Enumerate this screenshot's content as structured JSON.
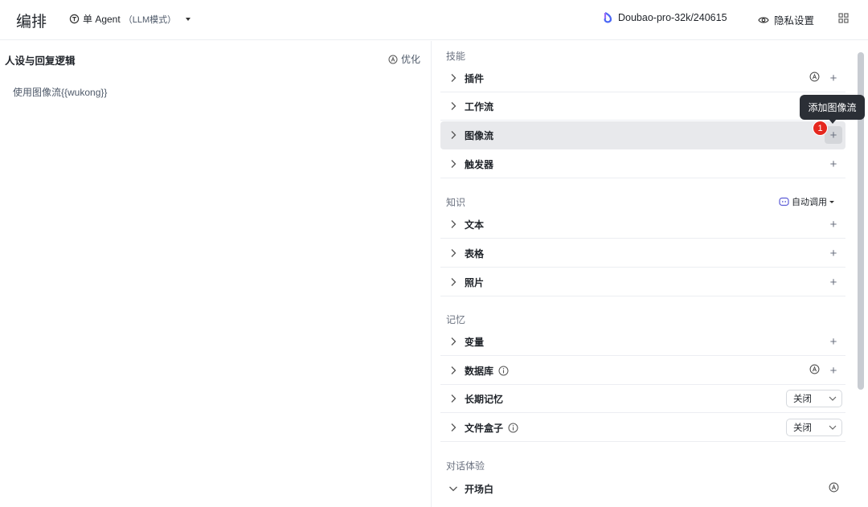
{
  "header": {
    "title": "编排",
    "mode_label": "单 Agent",
    "mode_sub": "（LLM模式）",
    "model": "Doubao-pro-32k/240615",
    "privacy": "隐私设置"
  },
  "left": {
    "title": "人设与回复逻辑",
    "optimize": "优化",
    "prompt": "使用图像流{{wukong}}"
  },
  "skills": {
    "title": "技能",
    "items": [
      {
        "label": "插件"
      },
      {
        "label": "工作流"
      },
      {
        "label": "图像流"
      },
      {
        "label": "触发器"
      }
    ]
  },
  "knowledge": {
    "title": "知识",
    "auto_call": "自动调用",
    "items": [
      {
        "label": "文本"
      },
      {
        "label": "表格"
      },
      {
        "label": "照片"
      }
    ]
  },
  "memory": {
    "title": "记忆",
    "items": [
      {
        "label": "变量"
      },
      {
        "label": "数据库"
      },
      {
        "label": "长期记忆",
        "value": "关闭"
      },
      {
        "label": "文件盒子",
        "value": "关闭"
      }
    ]
  },
  "dialog": {
    "title": "对话体验",
    "items": [
      {
        "label": "开场白"
      }
    ]
  },
  "tooltip": {
    "text": "添加图像流",
    "badge": "1"
  },
  "icons": {
    "plus": "+"
  },
  "colors": {
    "tooltip_bg": "#2b2f36",
    "badge": "#e5271e",
    "hover_row": "#e8e9ec",
    "auto_call_icon": "#5b5bd6"
  }
}
